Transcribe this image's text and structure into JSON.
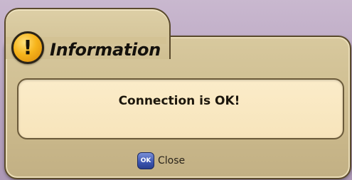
{
  "dialog": {
    "title": "Information",
    "message": "Connection is OK!",
    "warning_icon": "exclamation-circle-icon",
    "warning_glyph": "!",
    "close": {
      "icon": "ok-button-icon",
      "icon_glyph": "OK",
      "label": "Close"
    }
  },
  "colors": {
    "dialog_background": "#cbb98c",
    "message_background": "#f9e8c2",
    "warning_badge": "#f7b51c",
    "ok_badge": "#3c55b0",
    "screen_background": "#b9a7c2"
  }
}
